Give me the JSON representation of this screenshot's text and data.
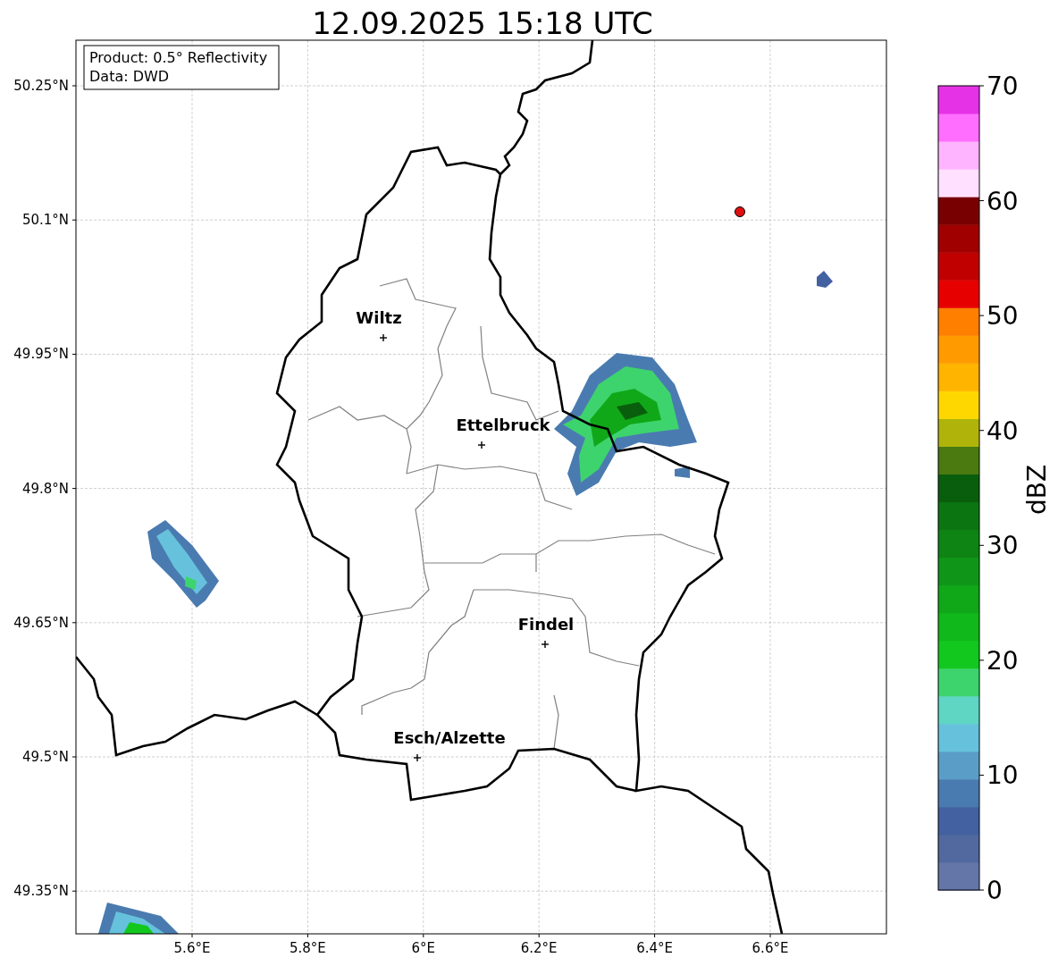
{
  "title": "12.09.2025 15:18 UTC",
  "info_box": [
    "Product: 0.5° Reflectivity",
    "Data: DWD"
  ],
  "map": {
    "y_ticks": [
      "50.25°N",
      "50.1°N",
      "49.95°N",
      "49.8°N",
      "49.65°N",
      "49.5°N",
      "49.35°N"
    ],
    "x_ticks": [
      "5.6°E",
      "5.8°E",
      "6°E",
      "6.2°E",
      "6.4°E",
      "6.6°E"
    ],
    "cities": [
      {
        "name": "Wiltz"
      },
      {
        "name": "Ettelbruck"
      },
      {
        "name": "Findel"
      },
      {
        "name": "Esch/Alzette"
      }
    ]
  },
  "colorbar": {
    "label": "dBZ",
    "ticks": [
      "70",
      "60",
      "50",
      "40",
      "30",
      "20",
      "10",
      "0"
    ],
    "segments": [
      {
        "color": "#6475a8"
      },
      {
        "color": "#52699f"
      },
      {
        "color": "#4361a1"
      },
      {
        "color": "#4a7bb0"
      },
      {
        "color": "#5a9ec8"
      },
      {
        "color": "#66c2dc"
      },
      {
        "color": "#5fd6c4"
      },
      {
        "color": "#3dd46e"
      },
      {
        "color": "#12c81e"
      },
      {
        "color": "#10b81b"
      },
      {
        "color": "#10a818"
      },
      {
        "color": "#0f9618"
      },
      {
        "color": "#0e8414"
      },
      {
        "color": "#0b7512"
      },
      {
        "color": "#095e0d"
      },
      {
        "color": "#4a7a10"
      },
      {
        "color": "#b0b40a"
      },
      {
        "color": "#ffd700"
      },
      {
        "color": "#ffb400"
      },
      {
        "color": "#ff9b00"
      },
      {
        "color": "#ff7f00"
      },
      {
        "color": "#e60000"
      },
      {
        "color": "#c00000"
      },
      {
        "color": "#a00000"
      },
      {
        "color": "#780000"
      },
      {
        "color": "#ffe0ff"
      },
      {
        "color": "#ffb4ff"
      },
      {
        "color": "#ff6eff"
      },
      {
        "color": "#e632e6"
      }
    ]
  }
}
